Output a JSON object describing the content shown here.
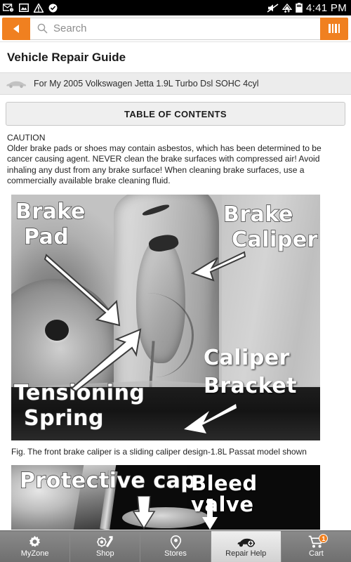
{
  "statusbar": {
    "time": "4:41 PM",
    "left_icons": [
      "mail-icon",
      "image-icon",
      "warning-icon",
      "checkmark-badge-icon"
    ],
    "right_icons": [
      "mute-icon",
      "wifi-icon",
      "battery-icon"
    ]
  },
  "searchbar": {
    "back_label": "back-arrow",
    "placeholder": "Search",
    "value": "",
    "scan_label": "barcode-scanner"
  },
  "page": {
    "title": "Vehicle Repair Guide",
    "vehicle": "For My 2005 Volkswagen Jetta  1.9L Turbo Dsl SOHC 4cyl",
    "toc_label": "TABLE OF CONTENTS",
    "caution_head": "CAUTION",
    "caution_body": "Older brake pads or shoes may contain asbestos, which has been determined to be cancer causing agent. NEVER clean the brake surfaces with compressed air! Avoid inhaling any dust from any brake surface! When cleaning brake surfaces, use a commercially available brake cleaning fluid."
  },
  "figure1": {
    "labels": {
      "brake_pad": "Brake\nPad",
      "brake_pad_l1": "Brake",
      "brake_pad_l2": "Pad",
      "brake_caliper_l1": "Brake",
      "brake_caliper_l2": "Caliper",
      "tensioning_l1": "Tensioning",
      "tensioning_l2": "Spring",
      "caliper_bracket_l1": "Caliper",
      "caliper_bracket_l2": "Bracket"
    },
    "caption": "Fig. The front brake caliper is a sliding caliper design-1.8L Passat model shown"
  },
  "figure2": {
    "labels": {
      "protective_cap": "Protective cap",
      "bleed_valve": "Bleed valve"
    }
  },
  "tabbar": {
    "items": [
      {
        "label": "MyZone",
        "icon": "gear-icon",
        "active": false,
        "badge": ""
      },
      {
        "label": "Shop",
        "icon": "auto-parts-icon",
        "active": false,
        "badge": ""
      },
      {
        "label": "Stores",
        "icon": "map-pin-icon",
        "active": false,
        "badge": ""
      },
      {
        "label": "Repair Help",
        "icon": "car-wrench-icon",
        "active": true,
        "badge": ""
      },
      {
        "label": "Cart",
        "icon": "shopping-cart-icon",
        "active": false,
        "badge": "1"
      }
    ]
  },
  "colors": {
    "accent_orange": "#f08020",
    "tabbar_gray": "#777777",
    "active_tab": "#e4e4e4"
  }
}
